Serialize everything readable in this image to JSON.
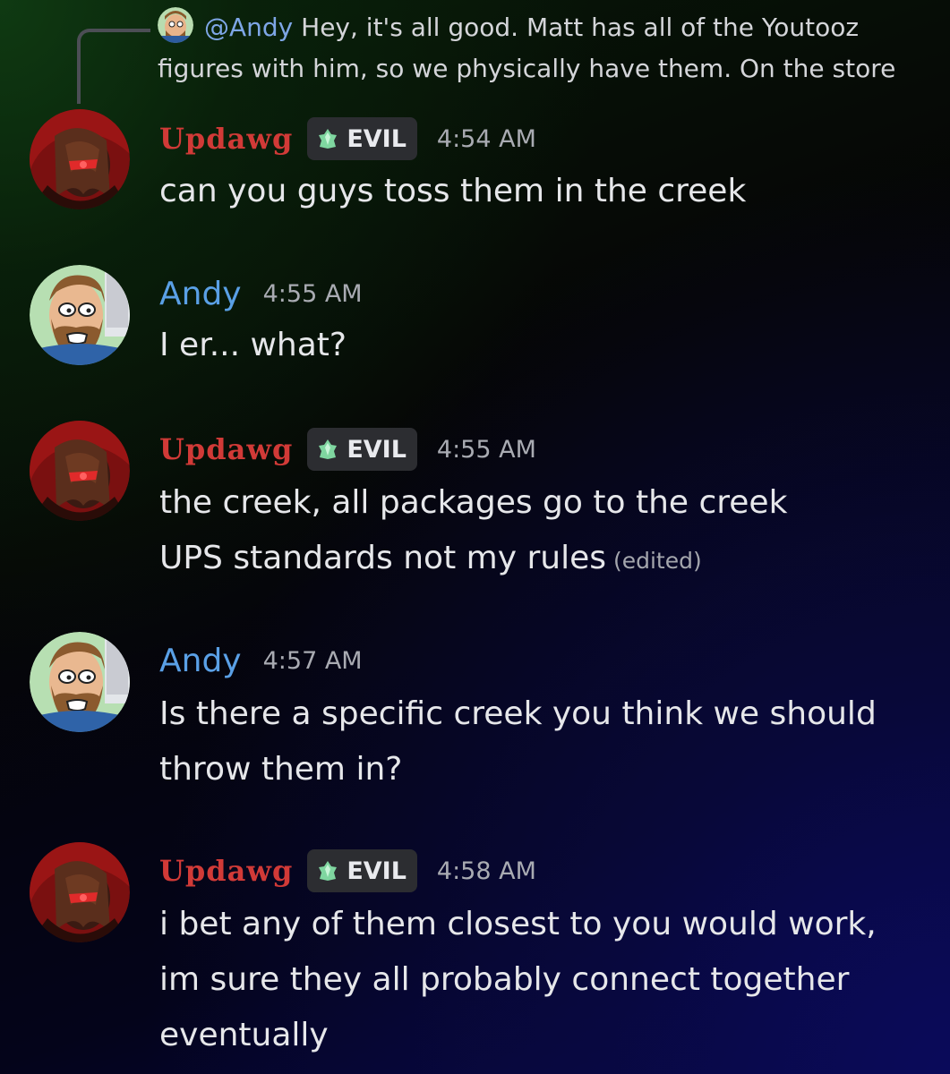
{
  "reply": {
    "mention": "@Andy",
    "text_line1": " Hey, it's all good. Matt has all of the Youtooz",
    "text_line2": "figures with him, so we physically have them. On the store"
  },
  "messages": [
    {
      "author": "Updawg",
      "tag_label": "EVIL",
      "timestamp": "4:54 AM",
      "lines": [
        "can you guys toss them in the creek"
      ]
    },
    {
      "author": "Andy",
      "timestamp": "4:55 AM",
      "lines": [
        "I er... what?"
      ]
    },
    {
      "author": "Updawg",
      "tag_label": "EVIL",
      "timestamp": "4:55 AM",
      "lines": [
        "the creek, all packages go to the creek",
        "UPS standards not my rules"
      ],
      "edited_label": "(edited)"
    },
    {
      "author": "Andy",
      "timestamp": "4:57 AM",
      "lines": [
        "Is there a specific creek you think we should",
        "throw them in?"
      ]
    },
    {
      "author": "Updawg",
      "tag_label": "EVIL",
      "timestamp": "4:58 AM",
      "lines": [
        "i bet any of them closest to you would work,",
        "im sure they all probably connect together",
        "eventually"
      ]
    }
  ],
  "colors": {
    "updawg_name": "#d13a37",
    "andy_name": "#5aa0e6",
    "mention": "#7ea6e6",
    "tag_bg": "#2c2d31",
    "timestamp": "#a9abb2"
  },
  "icons": {
    "tag_icon": "green-crystal-icon"
  }
}
